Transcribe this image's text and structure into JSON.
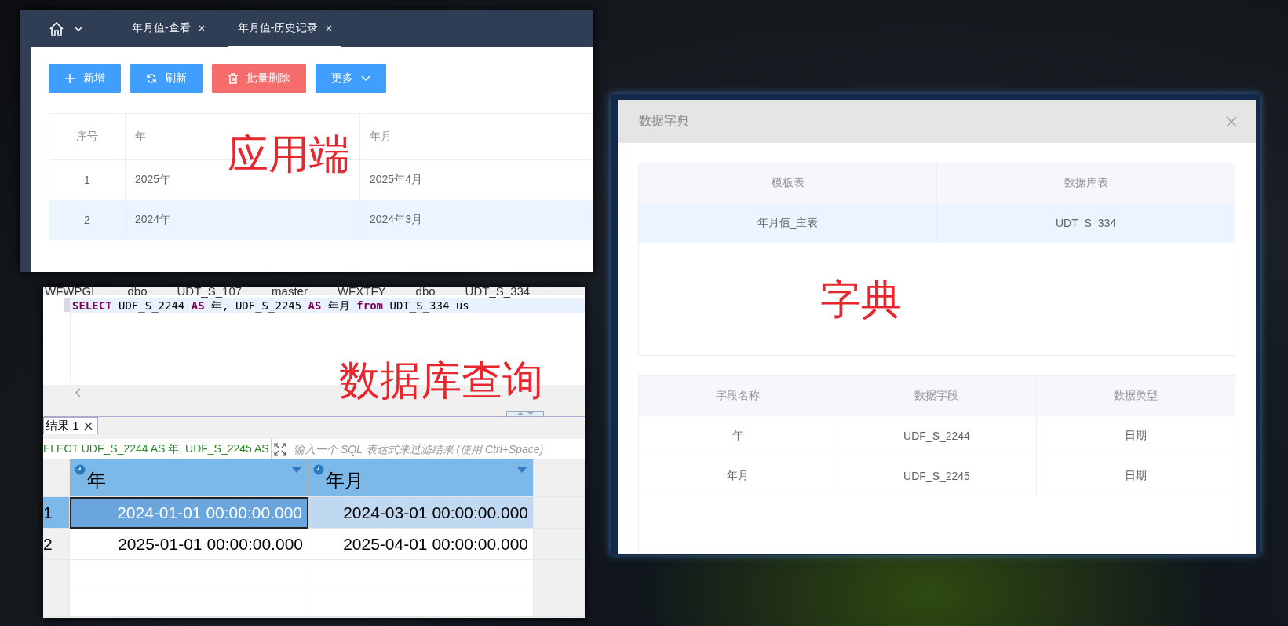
{
  "app_window": {
    "tabs": [
      {
        "label": "年月值-查看",
        "selected": false
      },
      {
        "label": "年月值-历史记录",
        "selected": true
      }
    ],
    "buttons": [
      {
        "kind": "add",
        "label": "新增"
      },
      {
        "kind": "refresh",
        "label": "刷新"
      },
      {
        "kind": "delete",
        "label": "批量删除"
      },
      {
        "kind": "more",
        "label": "更多"
      }
    ],
    "table": {
      "columns": [
        "序号",
        "年",
        "年月"
      ],
      "rows": [
        {
          "cells": [
            "1",
            "2025年",
            "2025年4月"
          ],
          "selected": false
        },
        {
          "cells": [
            "2",
            "2024年",
            "2024年3月"
          ],
          "selected": true
        }
      ]
    },
    "annotation": "应用端"
  },
  "query_window": {
    "toolbar": [
      "WFWPGL",
      "dbo",
      "UDT_S_107",
      "master",
      "WFXTFY",
      "dbo",
      "UDT_S_334"
    ],
    "sql_line": "**SELECT** UDF_S_2244 **AS** 年, UDF_S_2245 **AS** 年月 **from** UDT_S_334 us",
    "annotation": "数据库查询",
    "result_tab": "结果 1",
    "filter_query": "ELECT UDF_S_2244 AS 年, UDF_S_2245 AS",
    "filter_placeholder": "输入一个 SQL 表达式来过滤结果 (使用 Ctrl+Space)",
    "grid": {
      "columns": [
        "年",
        "年月"
      ],
      "rows": [
        {
          "number": "1",
          "cells": [
            "2024-01-01 00:00:00.000",
            "2024-03-01 00:00:00.000"
          ],
          "selected": true
        },
        {
          "number": "2",
          "cells": [
            "2025-01-01 00:00:00.000",
            "2025-04-01 00:00:00.000"
          ],
          "selected": false
        }
      ]
    }
  },
  "dictionary_dialog": {
    "title": "数据字典",
    "table_map": {
      "columns": [
        "模板表",
        "数据库表"
      ],
      "rows": [
        {
          "cells": [
            "年月值_主表",
            "UDT_S_334"
          ],
          "selected": true
        }
      ]
    },
    "annotation": "字典",
    "field_table": {
      "columns": [
        "字段名称",
        "数据字段",
        "数据类型"
      ],
      "rows": [
        {
          "cells": [
            "年",
            "UDF_S_2244",
            "日期"
          ],
          "selected": false
        },
        {
          "cells": [
            "年月",
            "UDF_S_2245",
            "日期"
          ],
          "selected": false
        }
      ]
    }
  }
}
